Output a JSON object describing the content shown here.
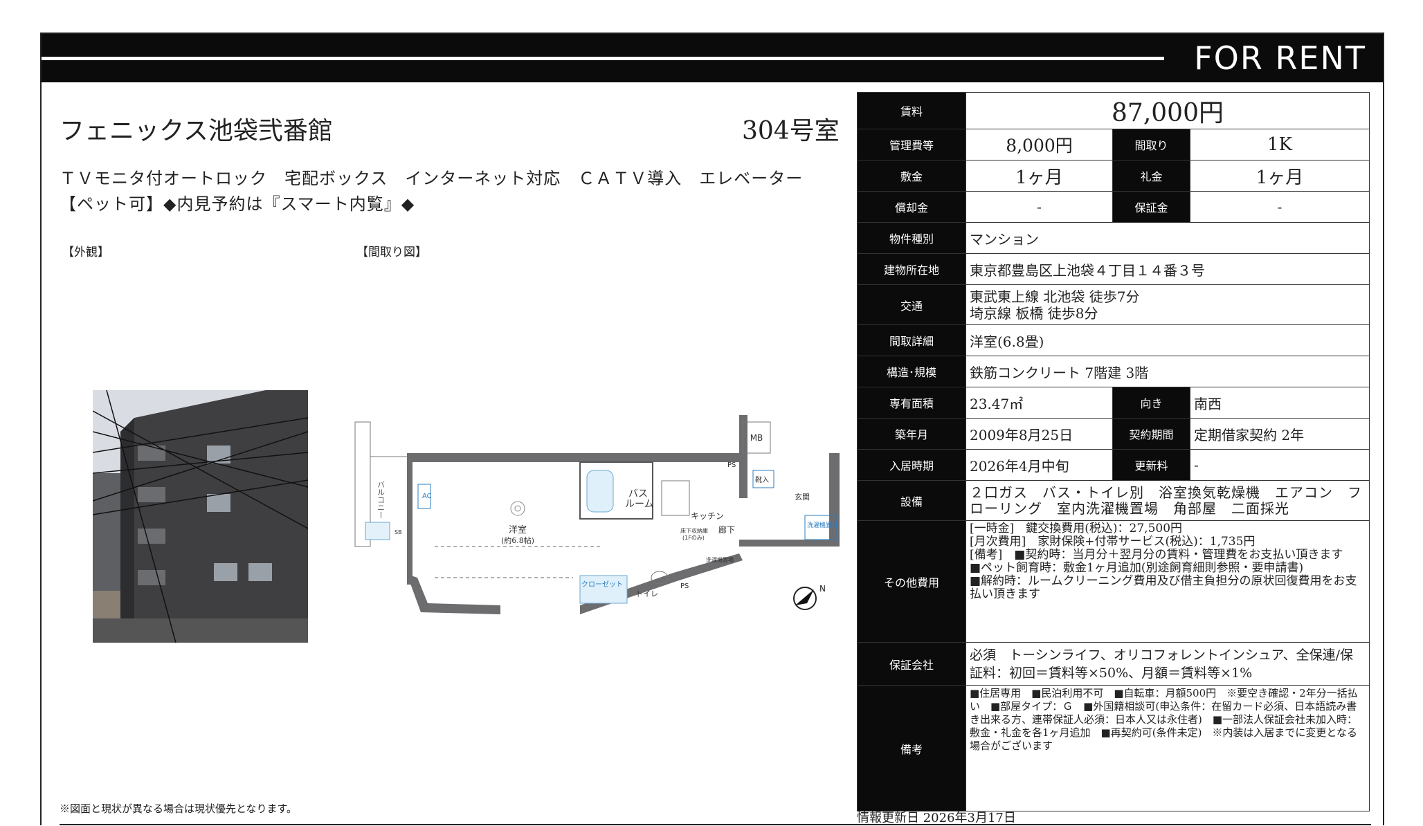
{
  "banner": {
    "title": "FOR RENT"
  },
  "property": {
    "name": "フェニックス池袋弐番館",
    "room": "304号室",
    "features_line1": "ＴＶモニタ付オートロック　宅配ボックス　インターネット対応　ＣＡＴＶ導入　エレベーター",
    "features_line2": "【ペット可】◆内見予約は『スマート内覧』◆"
  },
  "labels": {
    "exterior": "【外観】",
    "floorplan": "【間取り図】"
  },
  "floorplan_text": {
    "mb": "MB",
    "balcony": "バルコニー",
    "ac": "AC",
    "western_room": "洋室",
    "western_room_size": "(約6.8帖)",
    "bath": "バス",
    "bath2": "ルーム",
    "kitchen": "キッチン",
    "hall": "廊下",
    "entrance": "玄関",
    "closet": "クローゼット",
    "toilet": "トイレ",
    "ps": "PS",
    "shoes": "靴入",
    "washer": "洗濯機置場",
    "underfloor": "床下収納庫",
    "underfloor2": "(1Fのみ)",
    "compass": "N",
    "sb": "SB",
    "ps2": "PS",
    "wash2": "洗濯機置場"
  },
  "spec": {
    "rent_label": "賃料",
    "rent": "87,000円",
    "mgmt_label": "管理費等",
    "mgmt": "8,000円",
    "layout_label": "間取り",
    "layout": "1K",
    "deposit_label": "敷金",
    "deposit": "1ヶ月",
    "keymoney_label": "礼金",
    "keymoney": "1ヶ月",
    "amort_label": "償却金",
    "amort": "-",
    "guarantee_label": "保証金",
    "guarantee": "-",
    "type_label": "物件種別",
    "type": "マンション",
    "address_label": "建物所在地",
    "address": "東京都豊島区上池袋４丁目１４番３号",
    "access_label": "交通",
    "access1": "東武東上線 北池袋 徒歩7分",
    "access2": "埼京線 板橋 徒歩8分",
    "detail_label": "間取詳細",
    "detail": "洋室(6.8畳)",
    "structure_label": "構造･規模",
    "structure": "鉄筋コンクリート 7階建 3階",
    "area_label": "専有面積",
    "area": "23.47㎡",
    "direction_label": "向き",
    "direction": "南西",
    "built_label": "築年月",
    "built": "2009年8月25日",
    "contract_label": "契約期間",
    "contract": "定期借家契約 2年",
    "movein_label": "入居時期",
    "movein": "2026年4月中旬",
    "renewal_label": "更新料",
    "renewal": "-",
    "equipment_label": "設備",
    "equipment": "２口ガス　バス・トイレ別　浴室換気乾燥機　エアコン　フローリング　室内洗濯機置場　角部屋　二面採光",
    "other_label": "その他費用",
    "other1": "[一時金]　鍵交換費用(税込)：27,500円",
    "other2": "[月次費用]　家財保険+付帯サービス(税込)：1,735円",
    "other3": "[備考]　■契約時：当月分＋翌月分の賃料・管理費をお支払い頂きます　■ペット飼育時：敷金1ヶ月追加(別途飼育細則参照・要申請書)",
    "other4": "■解約時：ルームクリーニング費用及び借主負担分の原状回復費用をお支払い頂きます",
    "gcompany_label": "保証会社",
    "gcompany": "必須　トーシンライフ、オリコフォレントインシュア、全保連/保証料：初回＝賃料等×50%、月額＝賃料等×1%",
    "remarks_label": "備考",
    "remarks": "■住居専用　■民泊利用不可　■自転車：月額500円　※要空き確認・2年分一括払い　■部屋タイプ：Ｇ　■外国籍相談可(申込条件：在留カード必須、日本語読み書き出来る方、連帯保証人必須：日本人又は永住者)　■一部法人保証会社未加入時：敷金・礼金を各1ヶ月追加　■再契約可(条件未定)　※内装は入居までに変更となる場合がございます"
  },
  "footer": {
    "note": "※図面と現状が異なる場合は現状優先となります。",
    "updated": "情報更新日 2026年3月17日"
  }
}
